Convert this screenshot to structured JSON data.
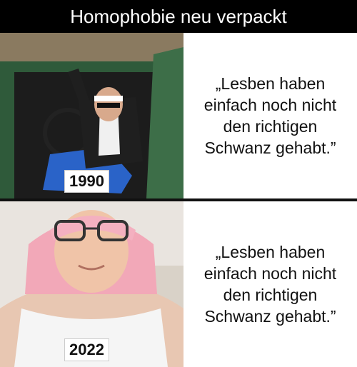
{
  "header": {
    "title": "Homophobie neu verpackt"
  },
  "panels": [
    {
      "year": "1990",
      "quote": "„Lesben haben einfach noch nicht den richtigen Schwanz gehabt.”"
    },
    {
      "year": "2022",
      "quote": "„Lesben haben einfach noch nicht den richtigen Schwanz gehabt.”"
    }
  ],
  "colors": {
    "background": "#ffffff",
    "title_bar": "#000000",
    "title_text": "#ffffff"
  }
}
